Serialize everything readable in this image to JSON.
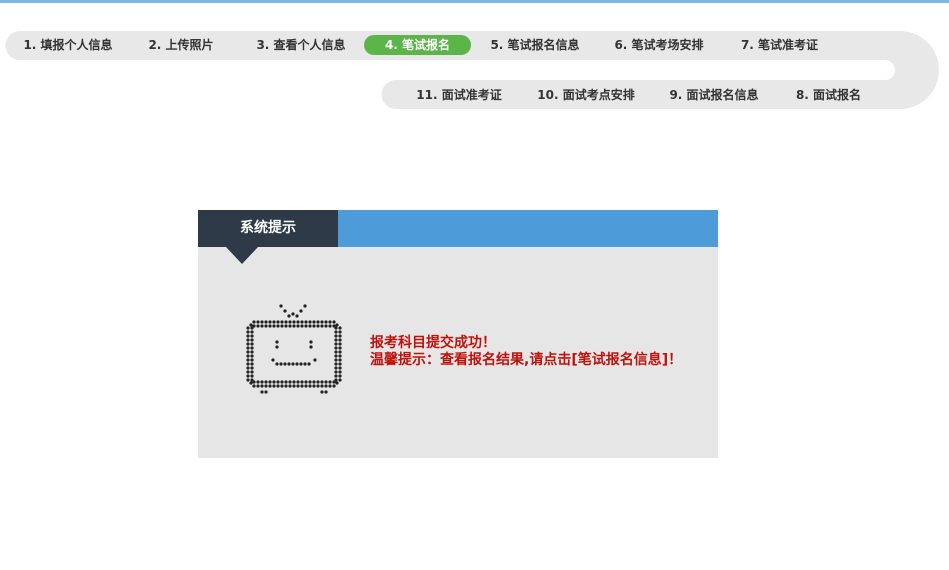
{
  "steps_row1": [
    {
      "label": "1. 填报个人信息",
      "active": false
    },
    {
      "label": "2. 上传照片",
      "active": false
    },
    {
      "label": "3. 查看个人信息",
      "active": false
    },
    {
      "label": "4. 笔试报名",
      "active": true
    },
    {
      "label": "5. 笔试报名信息",
      "active": false
    },
    {
      "label": "6. 笔试考场安排",
      "active": false
    },
    {
      "label": "7. 笔试准考证",
      "active": false
    }
  ],
  "steps_row2": [
    {
      "label": "11. 面试准考证",
      "active": false
    },
    {
      "label": "10. 面试考点安排",
      "active": false
    },
    {
      "label": "9. 面试报名信息",
      "active": false
    },
    {
      "label": "8. 面试报名",
      "active": false
    }
  ],
  "dialog": {
    "title": "系统提示",
    "line1": "报考科目提交成功！",
    "line2": "温馨提示：查看报名结果,请点击[笔试报名信息]！"
  },
  "colors": {
    "active_step": "#5bb548",
    "header_blue": "#4d9bd8",
    "header_dark": "#2e3a47",
    "message_red": "#c0120c",
    "track": "#e8e8e8"
  },
  "icons": [
    "tv-icon"
  ]
}
